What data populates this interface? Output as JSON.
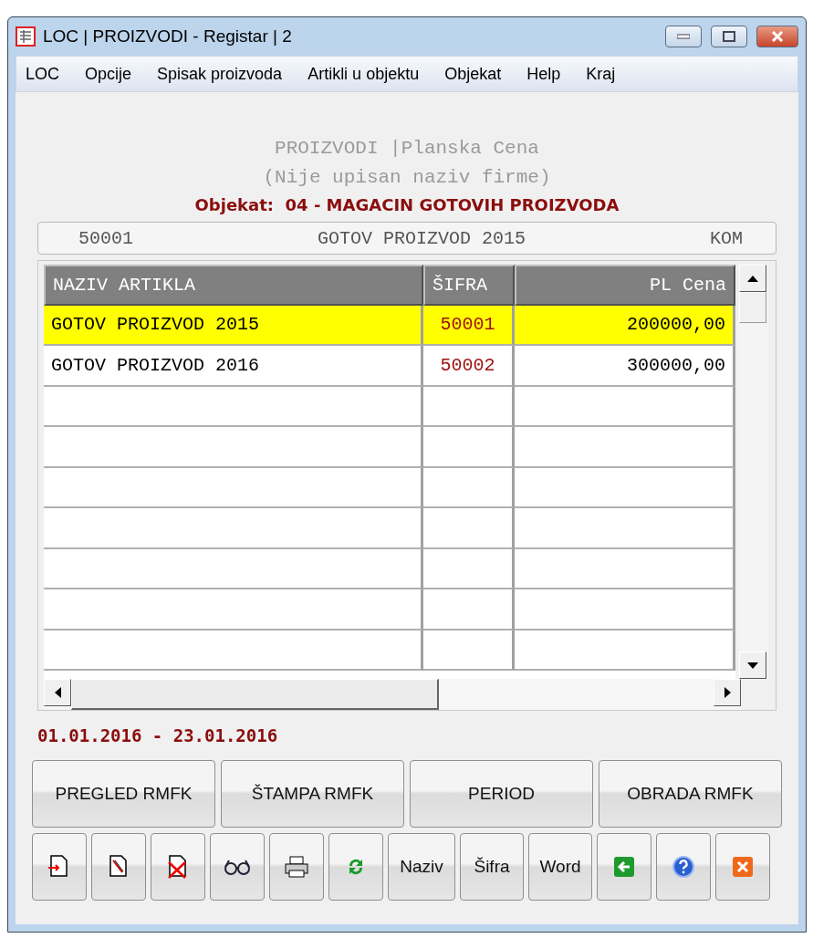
{
  "window": {
    "title": "LOC | PROIZVODI - Registar | 2"
  },
  "menu": [
    "LOC",
    "Opcije",
    "Spisak proizvoda",
    "Artikli u objektu",
    "Objekat",
    "Help",
    "Kraj"
  ],
  "header": {
    "title": "PROIZVODI |Planska Cena",
    "subtitle": "(Nije upisan naziv firme)",
    "object": "Objekat:  04 - MAGACIN GOTOVIH PROIZVODA"
  },
  "current": {
    "code": "50001",
    "name": "GOTOV PROIZVOD 2015",
    "unit": "KOM"
  },
  "table": {
    "columns": [
      "NAZIV ARTIKLA",
      "ŠIFRA",
      "PL Cena"
    ],
    "rows": [
      {
        "name": "GOTOV PROIZVOD 2015",
        "code": "50001",
        "price": "200000,00",
        "selected": true
      },
      {
        "name": "GOTOV PROIZVOD 2016",
        "code": "50002",
        "price": "300000,00",
        "selected": false
      }
    ]
  },
  "period": "01.01.2016 - 23.01.2016",
  "actions": [
    "PREGLED RMFK",
    "ŠTAMPA RMFK",
    "PERIOD",
    "OBRADA RMFK"
  ],
  "toolbar": [
    {
      "kind": "icon"
    },
    {
      "kind": "icon"
    },
    {
      "kind": "icon"
    },
    {
      "kind": "icon"
    },
    {
      "kind": "icon"
    },
    {
      "kind": "icon"
    },
    {
      "kind": "text",
      "label": "Naziv"
    },
    {
      "kind": "text",
      "label": "Šifra"
    },
    {
      "kind": "text",
      "label": "Word"
    },
    {
      "kind": "icon"
    },
    {
      "kind": "icon"
    },
    {
      "kind": "icon"
    }
  ]
}
